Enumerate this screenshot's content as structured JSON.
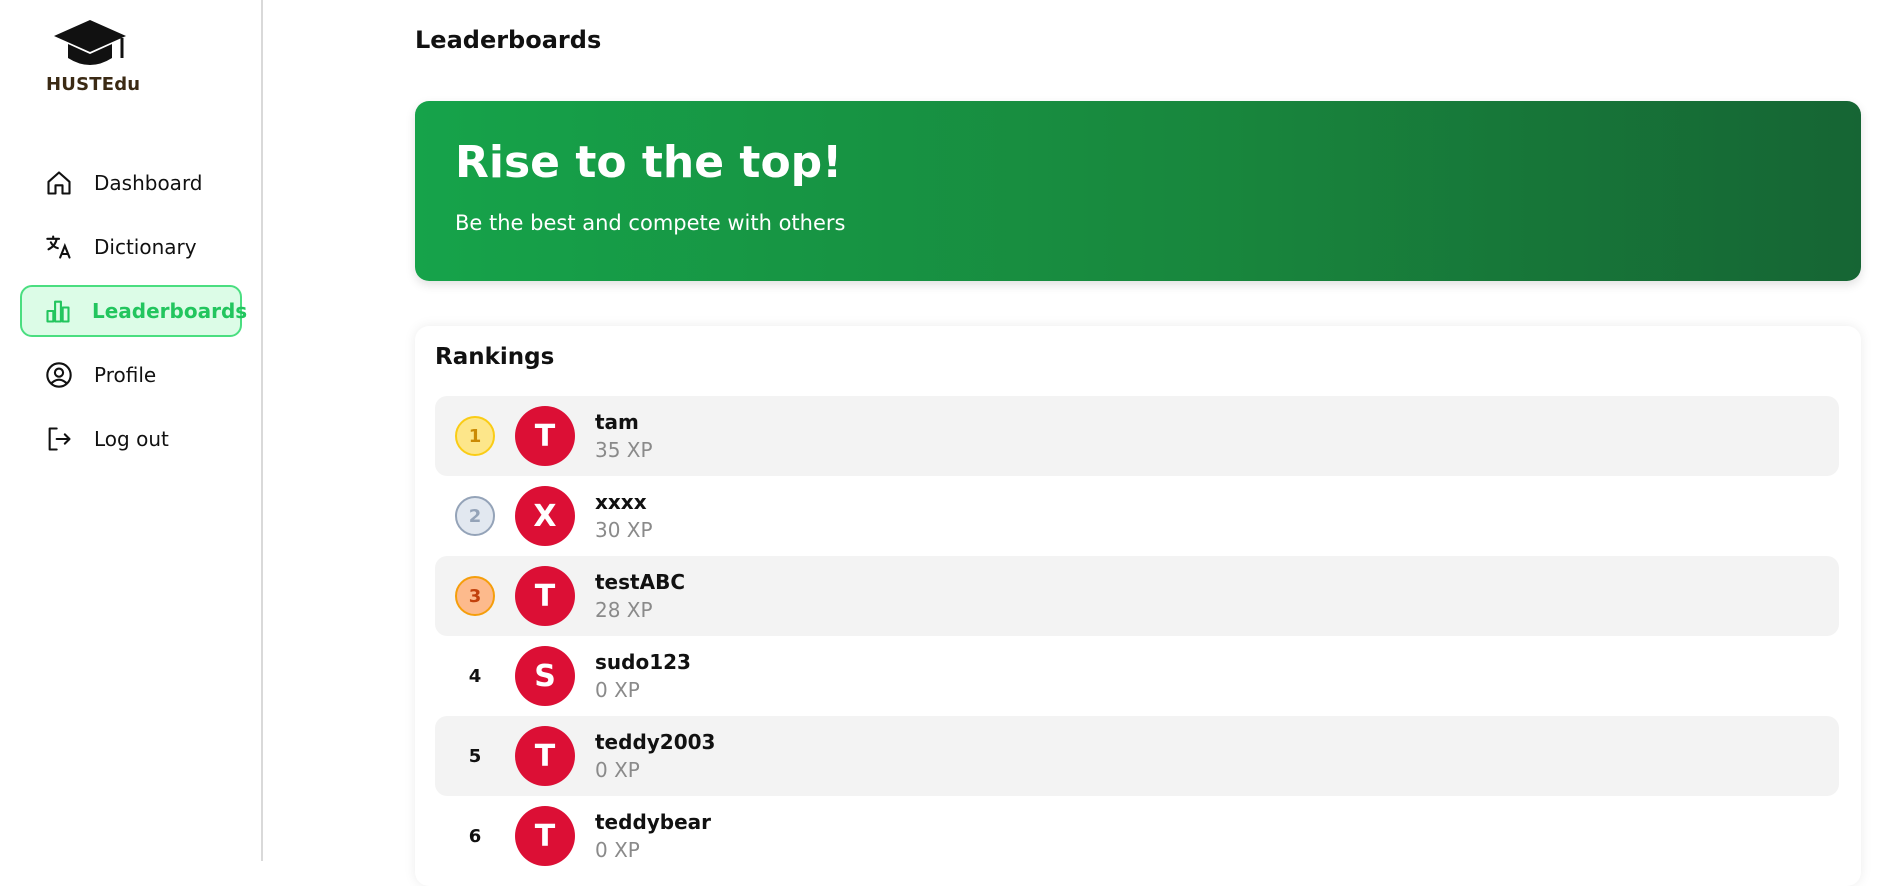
{
  "app": {
    "logo_text": "HUSTEdu"
  },
  "sidebar": {
    "items": [
      {
        "label": "Dashboard",
        "icon": "home-icon"
      },
      {
        "label": "Dictionary",
        "icon": "translate-icon"
      },
      {
        "label": "Leaderboards",
        "icon": "bar-chart-icon",
        "active": true
      },
      {
        "label": "Profile",
        "icon": "user-circle-icon"
      },
      {
        "label": "Log out",
        "icon": "logout-icon"
      }
    ]
  },
  "header": {
    "title": "Leaderboards"
  },
  "hero": {
    "title": "Rise to the top!",
    "subtitle": "Be the best and compete with others"
  },
  "rankings": {
    "title": "Rankings",
    "rows": [
      {
        "rank": "1",
        "initial": "T",
        "name": "tam",
        "xp": "35 XP"
      },
      {
        "rank": "2",
        "initial": "X",
        "name": "xxxx",
        "xp": "30 XP"
      },
      {
        "rank": "3",
        "initial": "T",
        "name": "testABC",
        "xp": "28 XP"
      },
      {
        "rank": "4",
        "initial": "S",
        "name": "sudo123",
        "xp": "0 XP"
      },
      {
        "rank": "5",
        "initial": "T",
        "name": "teddy2003",
        "xp": "0 XP"
      },
      {
        "rank": "6",
        "initial": "T",
        "name": "teddybear",
        "xp": "0 XP"
      }
    ]
  },
  "colors": {
    "accent": "#22c55e",
    "hero_start": "#16a34a",
    "hero_end": "#166534",
    "avatar": "#dc0f35",
    "gold": "#facc15",
    "silver": "#94a3b8",
    "bronze": "#f59e0b"
  }
}
